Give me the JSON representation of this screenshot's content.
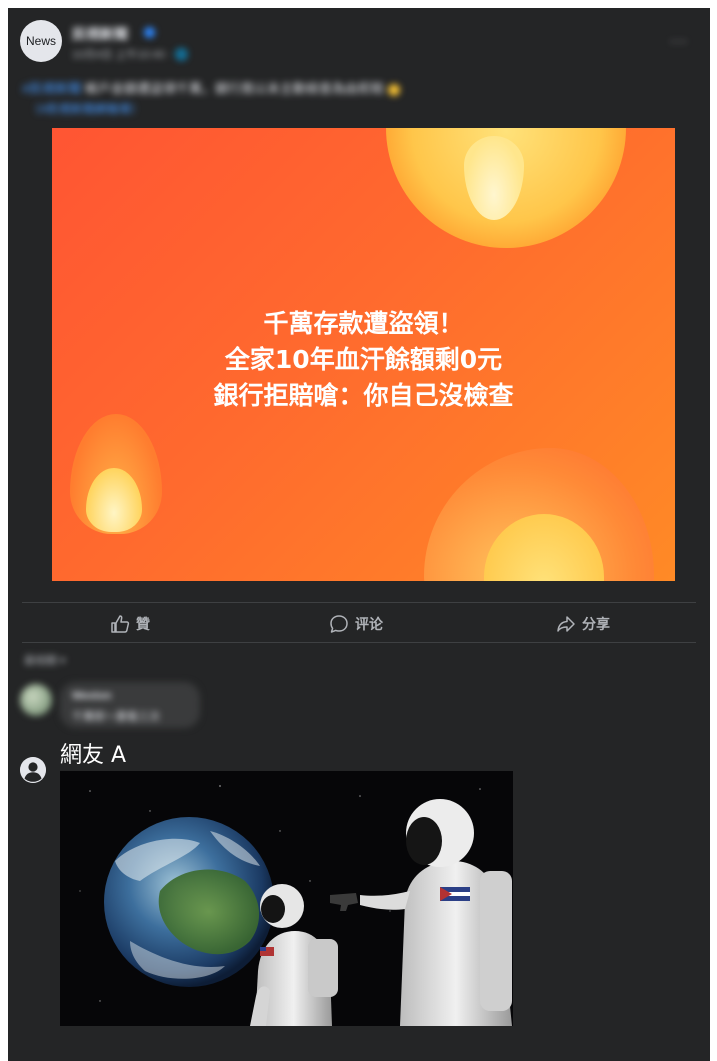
{
  "post": {
    "avatar_label": "News",
    "page_name": "民視新聞",
    "meta": "10月4日 上午10:40 · 🌐",
    "more": "···",
    "caption_link": "#民視新聞",
    "caption_text": "帳戶金額遭盜領千萬，銀行竟以未主動檢查為由拒賠",
    "caption_tag": "（#民視新聞網報導）"
  },
  "banner": {
    "line1": "千萬存款遭盜領！",
    "line2": "全家10年血汗餘額剩0元",
    "line3": "銀行拒賠嗆：你自己沒檢查"
  },
  "actions": {
    "like": "贊",
    "comment": "评论",
    "share": "分享"
  },
  "comments": {
    "sort": "最相關 ▾",
    "c1_name": "Weston",
    "c1_text": "千萬耶～要看三次",
    "c2_name": "網友 A"
  },
  "colors": {
    "card": "#242526",
    "banner_start": "#ff5533",
    "banner_end": "#ff8a26",
    "link": "#4599ff"
  }
}
